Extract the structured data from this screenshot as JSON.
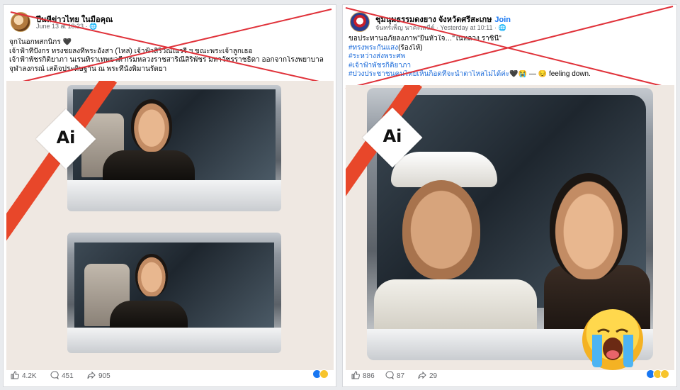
{
  "posts": [
    {
      "page_name": "ปีนหีข่าวไทย ในมือคุณ",
      "timestamp": "June 13 at 18:23 · 🌐",
      "text_lines": [
        "จุกในอกพสกนิกร 🖤",
        "เจ้าฟ้าทีปังกร ทรงชยลงที่พระอังสา (ไหล่) เจ้าฟ้าสิริวัณณวรี ฯ ขณะพระเจ้าลูกเธอ",
        "เจ้าฟ้าพัชรกิติยาภา นเรนทิราเทพยวดี กรมหลวงราชสาริณีสิริพัชร มหาวัชรราชธิดา ออกจากโรงพยาบาล",
        "จุฬาลงกรณ์ เสด็จประดิษฐาน ณ พระที่นั่งพิมานรัตยา"
      ],
      "badge_label": "Ai",
      "stats": {
        "likes": "4.2K",
        "comments": "451",
        "shares": "905"
      }
    },
    {
      "page_name": "ชุมนุมธรรมดงยาง จังหวัดศรีสะเกษ",
      "join_label": "Join",
      "meta": "จันทร์เพ็ญ นาคะเสนีย์ · Yesterday at 10:11 · 🌐",
      "intro": "ขอประทานอภัยลงภาพ\"ยืนหัวใจ…\"ในหลวง ราชินี\"",
      "hashtags": [
        "#ทรงพระกันแสง",
        "#ระหว่างส่งพระศพ",
        "#เจ้าฟ้าพัชรกิติยาภา",
        "#ปวงประชาชนคนไทยเห็นก็อดที่จะน้ำตาไหลไม่ได้ค่ะ"
      ],
      "hashtag_suffix_1": "(ร้องไห้)",
      "feeling": "🖤😭 — 😔 feeling down.",
      "badge_label": "Ai",
      "stats": {
        "likes": "886",
        "comments": "87",
        "shares": "29"
      }
    }
  ],
  "colors": {
    "cross": "#e0323a",
    "badge_stripe": "#e8472a",
    "link": "#216fdb"
  },
  "icons": [
    "like-icon",
    "comment-icon",
    "share-icon",
    "globe-icon",
    "crying-face-emoji"
  ]
}
